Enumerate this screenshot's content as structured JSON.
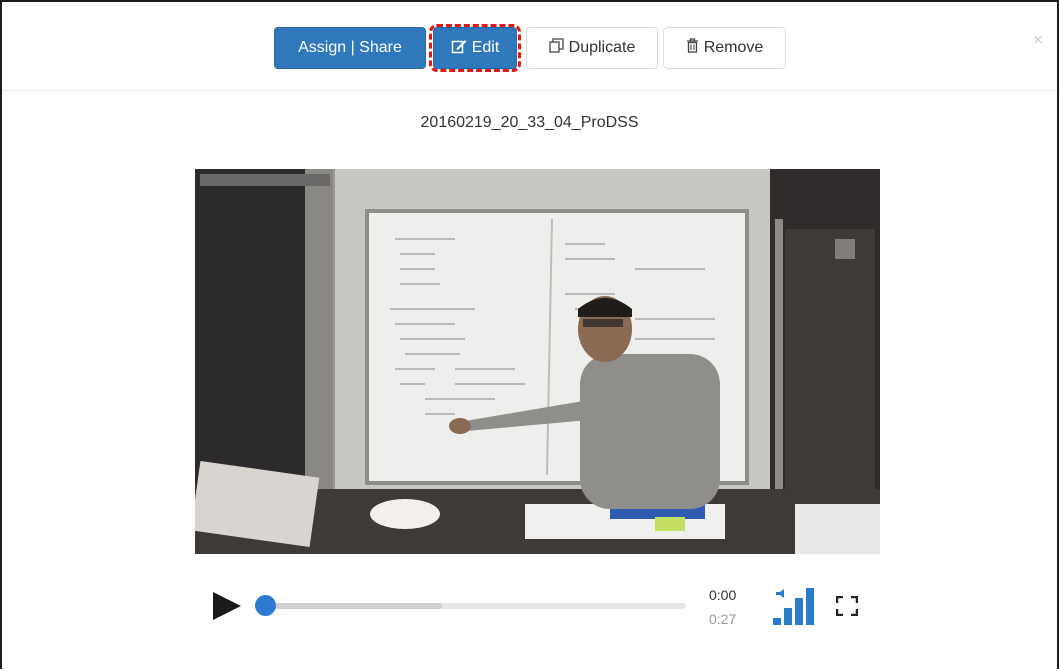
{
  "toolbar": {
    "assign_share_label": "Assign | Share",
    "edit_label": "Edit",
    "duplicate_label": "Duplicate",
    "remove_label": "Remove",
    "close_label": "×"
  },
  "video": {
    "title": "20160219_20_33_04_ProDSS",
    "current_time": "0:00",
    "duration": "0:27",
    "progress": 0.0,
    "buffered": 0.42
  },
  "icons": {
    "edit": "pencil-square-icon",
    "duplicate": "copy-icon",
    "remove": "trash-icon",
    "play": "play-icon",
    "volume": "volume-bars-icon",
    "fullscreen": "fullscreen-icon"
  },
  "colors": {
    "primary": "#2f78bc",
    "highlight": "#e01818",
    "progress_knob": "#2e7ad0",
    "volume": "#2a7bc8"
  }
}
